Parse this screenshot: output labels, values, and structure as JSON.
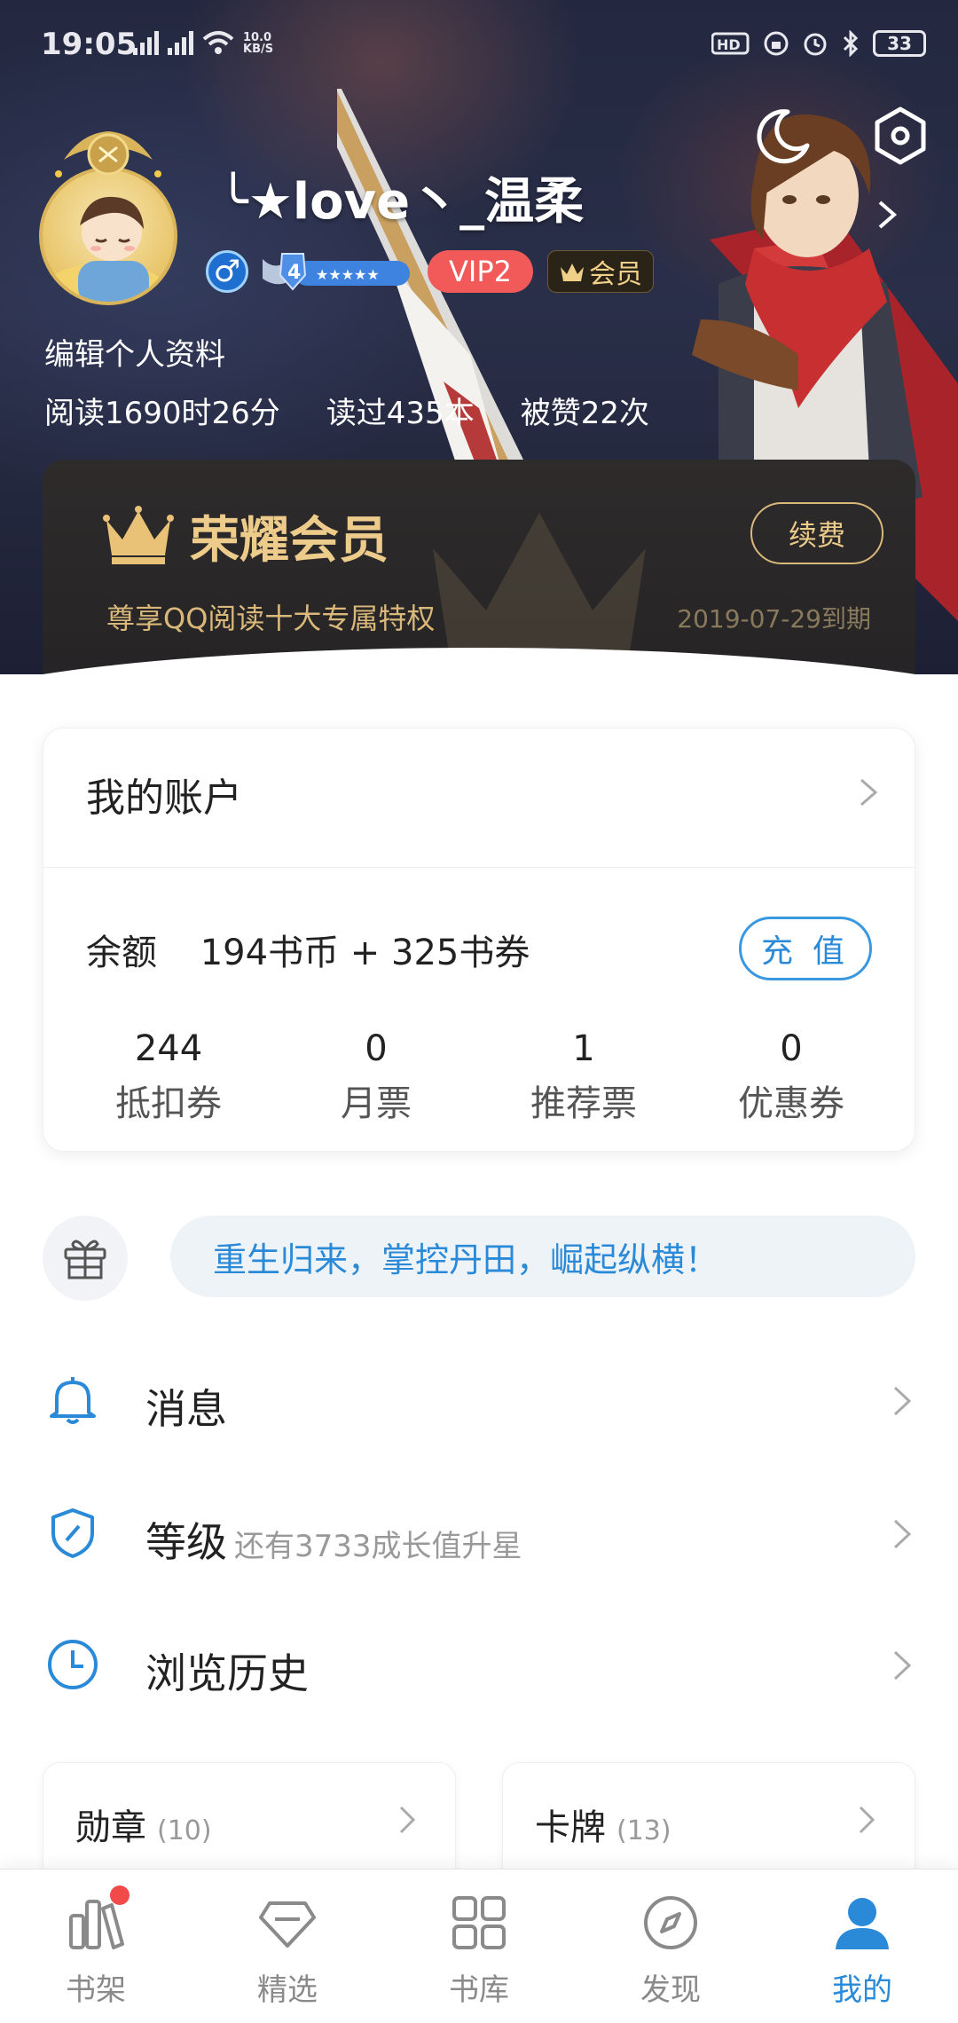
{
  "status_bar": {
    "time": "19:05",
    "net_speed_value": "10.0",
    "net_speed_unit": "KB/S",
    "battery": "33"
  },
  "profile": {
    "username": "╰★love丶_温柔",
    "level": "4",
    "vip_label": "VIP2",
    "member_label": "会员",
    "edit_label": "编辑个人资料",
    "stats": {
      "reading_time": "阅读1690时26分",
      "books_read": "读过435本",
      "likes": "被赞22次"
    }
  },
  "vip_card": {
    "title": "荣耀会员",
    "subtitle": "尊享QQ阅读十大专属特权",
    "expire": "2019-07-29到期",
    "renew_label": "续费"
  },
  "account": {
    "title": "我的账户",
    "balance_label": "余额",
    "balance_value": "194书币 + 325书券",
    "recharge_label": "充 值",
    "tickets": [
      {
        "value": "244",
        "label": "抵扣券"
      },
      {
        "value": "0",
        "label": "月票"
      },
      {
        "value": "1",
        "label": "推荐票"
      },
      {
        "value": "0",
        "label": "优惠券"
      }
    ]
  },
  "promo": {
    "text": "重生归来，掌控丹田，崛起纵横！"
  },
  "menu": [
    {
      "label": "消息",
      "sub": "",
      "icon": "bell-icon"
    },
    {
      "label": "等级",
      "sub": "还有3733成长值升星",
      "icon": "shield-icon"
    },
    {
      "label": "浏览历史",
      "sub": "",
      "icon": "clock-icon"
    }
  ],
  "tiles": [
    {
      "label": "勋章",
      "count": "(10)"
    },
    {
      "label": "卡牌",
      "count": "(13)"
    }
  ],
  "nav": [
    {
      "label": "书架",
      "icon": "bookshelf-icon"
    },
    {
      "label": "精选",
      "icon": "diamond-icon"
    },
    {
      "label": "书库",
      "icon": "grid-icon"
    },
    {
      "label": "发现",
      "icon": "compass-icon"
    },
    {
      "label": "我的",
      "icon": "person-icon"
    }
  ],
  "colors": {
    "accent_blue": "#2a8ad8",
    "vip_red": "#f25a5a",
    "gold": "#eccb8b",
    "header_dark": "#232840"
  }
}
